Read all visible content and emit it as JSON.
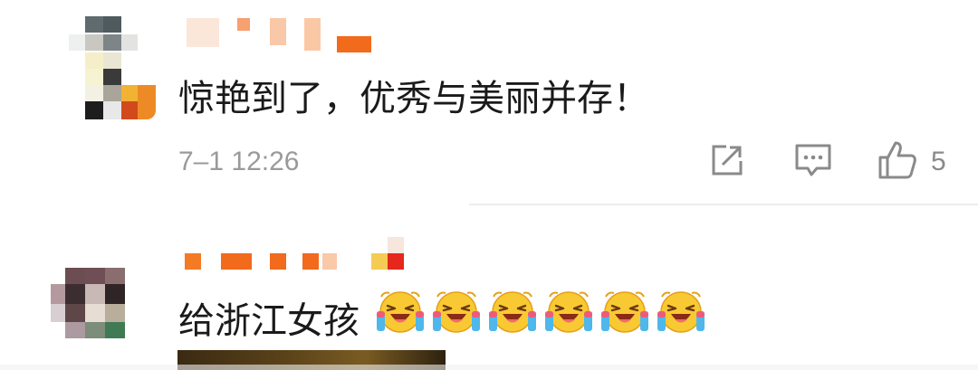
{
  "comments": [
    {
      "text": "惊艳到了，优秀与美丽并存！",
      "timestamp": "7–1 12:26",
      "actions": {
        "share_icon": "share-icon",
        "reply_icon": "comment-icon",
        "like_icon": "thumbs-up-icon",
        "like_count": "5"
      }
    },
    {
      "text": "给浙江女孩",
      "emoji_name": "laughing-crying-emoji",
      "emoji_count": 6
    }
  ]
}
